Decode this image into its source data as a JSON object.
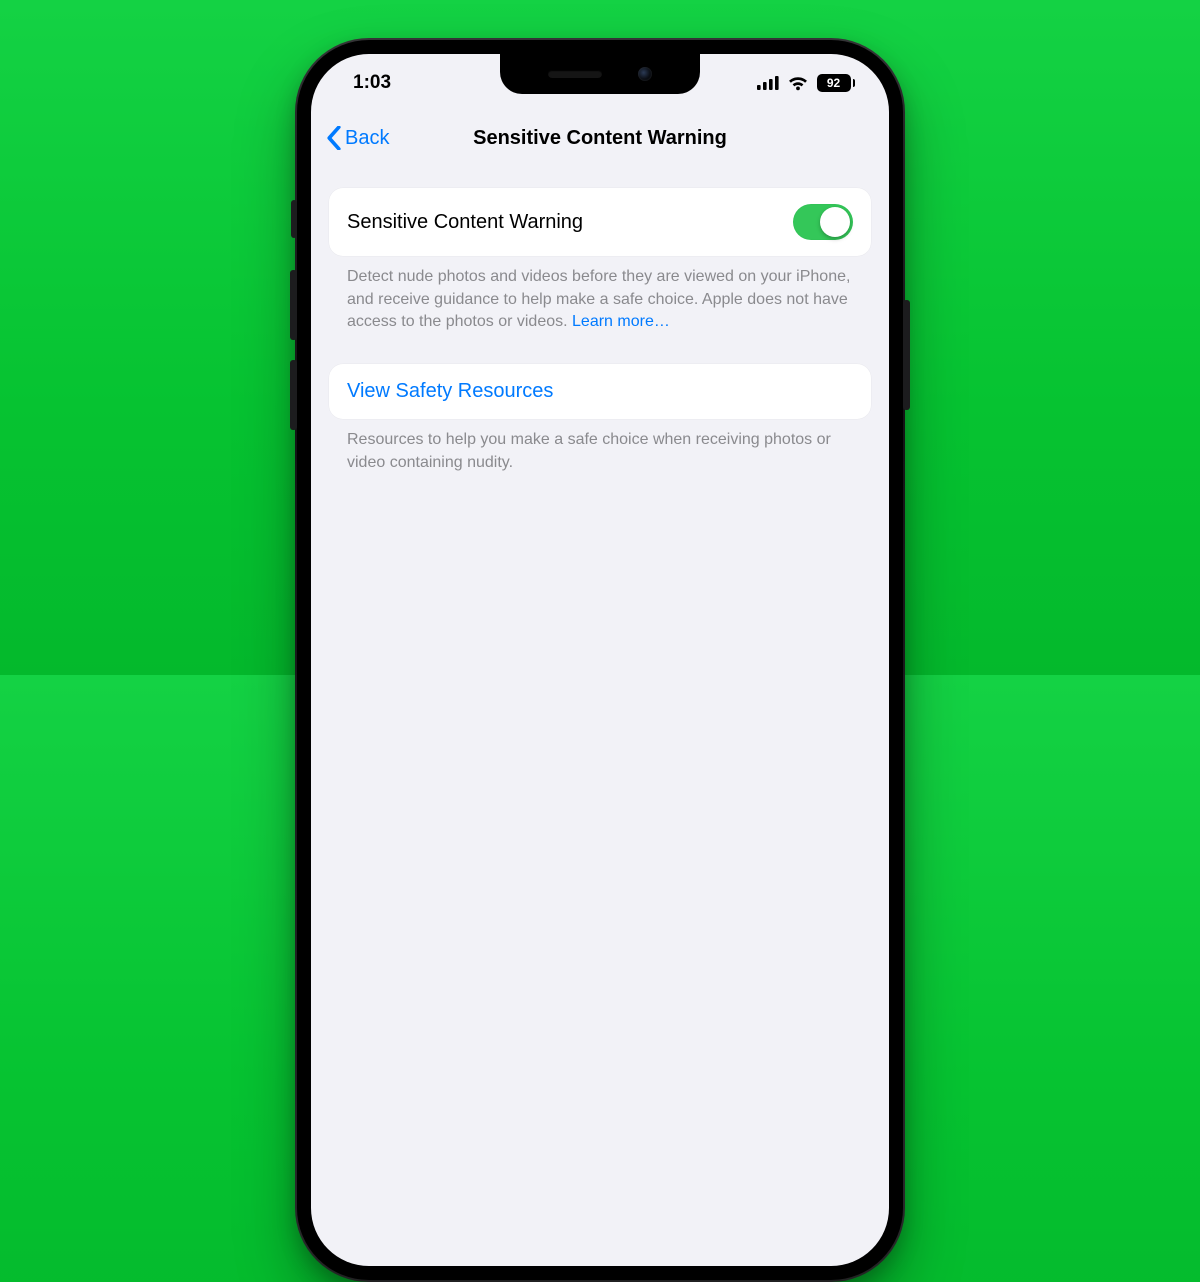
{
  "statusbar": {
    "time": "1:03",
    "battery_pct": "92"
  },
  "nav": {
    "back_label": "Back",
    "title": "Sensitive Content Warning"
  },
  "settings": {
    "toggle_label": "Sensitive Content Warning",
    "toggle_on": true,
    "description": "Detect nude photos and videos before they are viewed on your iPhone, and receive guidance to help make a safe choice. Apple does not have access to the photos or videos. ",
    "learn_more": "Learn more…"
  },
  "resources": {
    "link_label": "View Safety Resources",
    "description": "Resources to help you make a safe choice when receiving photos or video containing nudity."
  },
  "colors": {
    "ios_blue": "#007aff",
    "ios_green": "#34c759",
    "page_bg": "#0acc36"
  }
}
